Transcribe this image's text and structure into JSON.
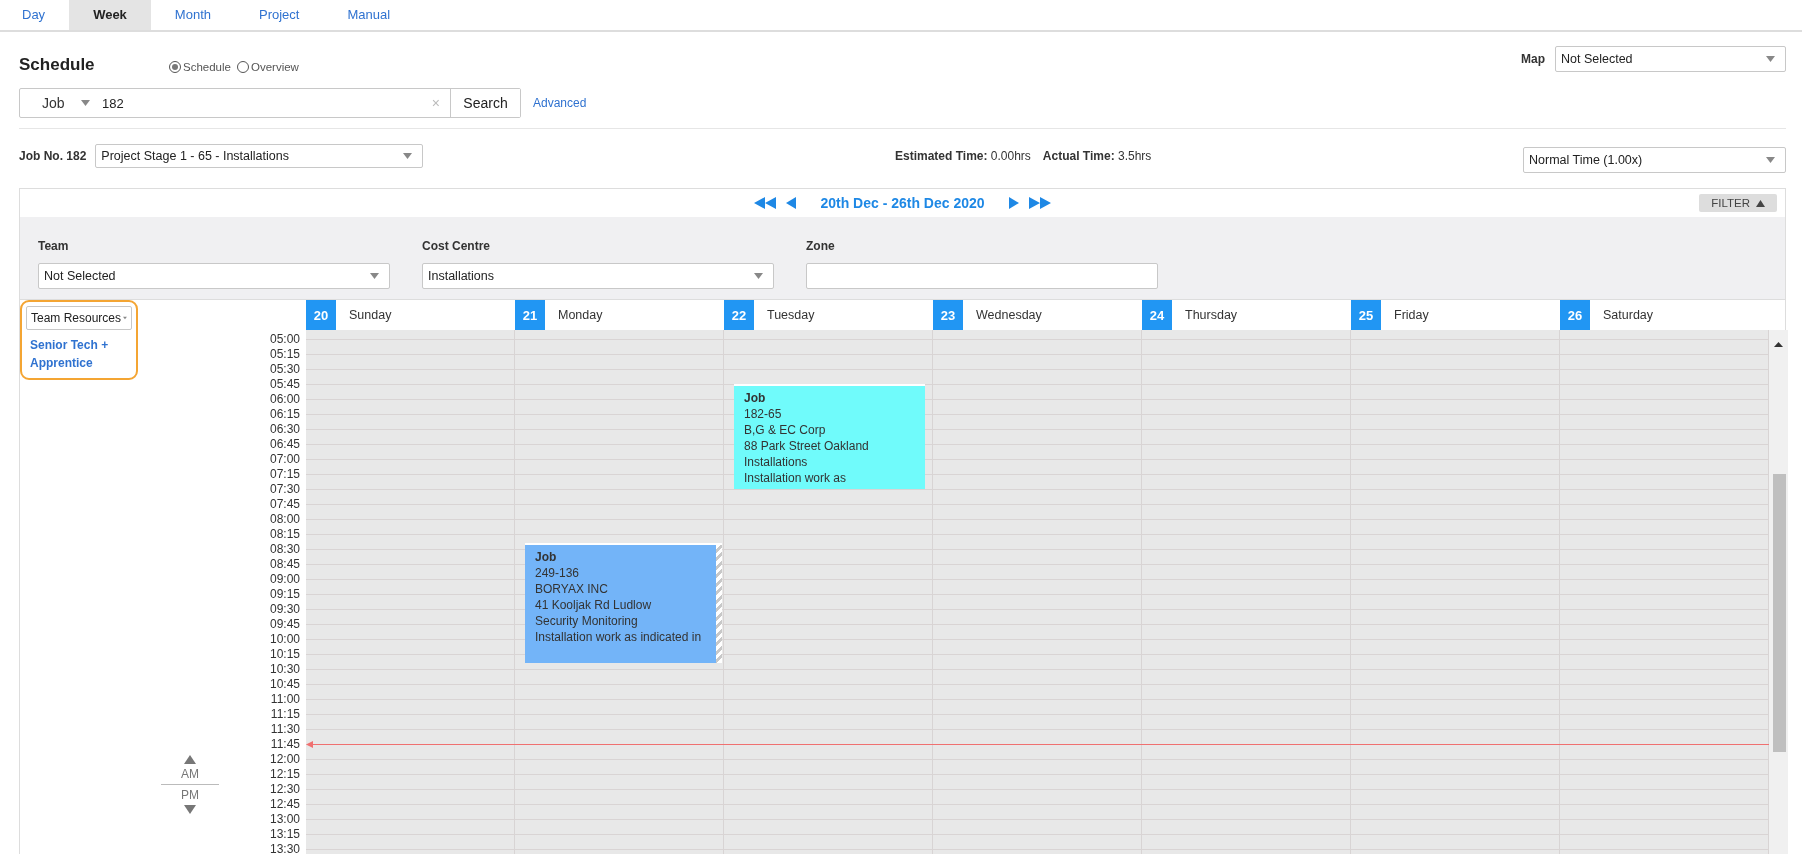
{
  "tabs": [
    {
      "label": "Day",
      "selected": false
    },
    {
      "label": "Week",
      "selected": true
    },
    {
      "label": "Month",
      "selected": false
    },
    {
      "label": "Project",
      "selected": false
    },
    {
      "label": "Manual",
      "selected": false
    }
  ],
  "page_title": "Schedule",
  "view_options": [
    {
      "label": "Schedule",
      "selected": true
    },
    {
      "label": "Overview",
      "selected": false
    }
  ],
  "map": {
    "label": "Map",
    "value": "Not Selected"
  },
  "search": {
    "type": "Job",
    "value": "182",
    "clear": "×",
    "button": "Search",
    "advanced": "Advanced"
  },
  "job": {
    "label": "Job No. 182",
    "stage": "Project Stage 1 - 65 - Installations",
    "estimated_label": "Estimated Time:",
    "estimated_value": "0.00hrs",
    "actual_label": "Actual Time:",
    "actual_value": "3.5hrs",
    "rate": "Normal Time (1.00x)"
  },
  "calendar": {
    "range": "20th Dec - 26th Dec 2020",
    "filter_button": "FILTER",
    "filters": [
      {
        "kind": "select",
        "label": "Team",
        "value": "Not Selected"
      },
      {
        "kind": "select",
        "label": "Cost Centre",
        "value": "Installations"
      },
      {
        "kind": "text",
        "label": "Zone"
      }
    ],
    "resource_select": "Team Resources",
    "resources": [
      "Senior Tech + Apprentice"
    ],
    "am": "AM",
    "pm": "PM",
    "times": [
      "05:00",
      "05:15",
      "05:30",
      "05:45",
      "06:00",
      "06:15",
      "06:30",
      "06:45",
      "07:00",
      "07:15",
      "07:30",
      "07:45",
      "08:00",
      "08:15",
      "08:30",
      "08:45",
      "09:00",
      "09:15",
      "09:30",
      "09:45",
      "10:00",
      "10:15",
      "10:30",
      "10:45",
      "11:00",
      "11:15",
      "11:30",
      "11:45",
      "12:00",
      "12:15",
      "12:30",
      "12:45",
      "13:00",
      "13:15",
      "13:30"
    ],
    "days": [
      {
        "number": "20",
        "name": "Sunday"
      },
      {
        "number": "21",
        "name": "Monday",
        "events": [
          {
            "title": "Job",
            "lines": [
              "249-136",
              "BORYAX INC",
              "41 Kooljak Rd Ludlow",
              "Security Monitoring",
              "Installation work as indicated in"
            ],
            "color": "#73b4f8",
            "hatched": true
          }
        ]
      },
      {
        "number": "22",
        "name": "Tuesday",
        "events": [
          {
            "title": "Job",
            "lines": [
              "182-65",
              "B,G & EC Corp",
              "88 Park Street Oakland",
              "Installations",
              "Installation work as"
            ],
            "color": "#70fbfb",
            "hatched": false
          }
        ]
      },
      {
        "number": "23",
        "name": "Wednesday"
      },
      {
        "number": "24",
        "name": "Thursday"
      },
      {
        "number": "25",
        "name": "Friday"
      },
      {
        "number": "26",
        "name": "Saturday"
      }
    ]
  }
}
